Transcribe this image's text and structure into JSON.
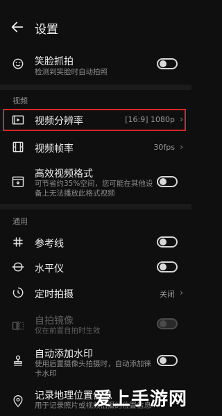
{
  "header": {
    "title": "设置"
  },
  "top": {
    "smile": {
      "label": "笑脸抓拍",
      "sub": "检测到笑脸时自动拍照",
      "on": false
    }
  },
  "sections": {
    "video": {
      "label": "视频",
      "resolution": {
        "label": "视频分辨率",
        "value": "[16:9] 1080p"
      },
      "framerate": {
        "label": "视频帧率",
        "value": "30fps"
      },
      "efficient": {
        "label": "高效视频格式",
        "sub": "可节省约35%空间，您可能在其他设备上无法播放此格式视频",
        "on": false
      }
    },
    "general": {
      "label": "通用",
      "grid": {
        "label": "参考线",
        "on": false
      },
      "level": {
        "label": "水平仪",
        "on": false
      },
      "timer": {
        "label": "定时拍摄",
        "value": "关闭"
      },
      "mirror": {
        "label": "自拍镜像",
        "sub": "仅在前置自拍时生效",
        "on": false,
        "disabled": true
      },
      "watermark": {
        "label": "自动添加水印",
        "sub": "使用后置摄像头拍摄时，自动添加徕卡水印",
        "on": false
      },
      "location": {
        "label": "记录地理位置信息",
        "sub": "用于记录照片或视频拍摄的位置信息"
      }
    }
  },
  "overlay": {
    "watermark_text": "爱上手游网"
  },
  "icons": [
    "back-arrow-icon",
    "smile-icon",
    "video-resolution-icon",
    "film-icon",
    "hevc-icon",
    "grid-icon",
    "level-icon",
    "timer-icon",
    "mirror-icon",
    "stamp-icon",
    "location-pin-icon",
    "chevron-right-icon"
  ],
  "colors": {
    "highlight": "#d9262a",
    "background": "#0f0f0f"
  }
}
